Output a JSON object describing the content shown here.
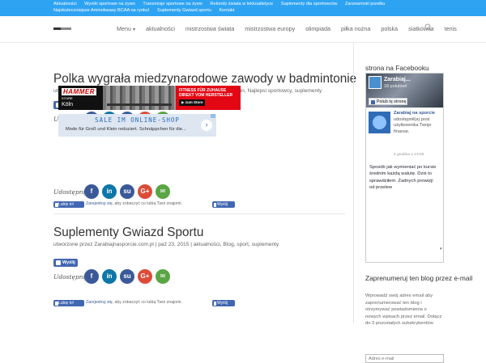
{
  "topbar": {
    "row1": [
      "Aktualności",
      "Wyniki sportowe na żywo",
      "Transmisje sportowe na żywo",
      "Rekordy świata w lekkoatletyce",
      "Suplementy dla sportowców",
      "Zarzewnioki przełku"
    ],
    "row2": [
      "Najskuteczniejsze Aminokwasy BCAA na rynku!",
      "Suplementy Gwiazd sportu",
      "Kontakt"
    ]
  },
  "nav": {
    "items": [
      "Menu",
      "aktualności",
      "mistrzostwa świata",
      "mistrzostwa europy",
      "olimpiada",
      "piłka nożna",
      "polska",
      "siatkówka",
      "tenis"
    ],
    "menu_arrow": "▾"
  },
  "posts": [
    {
      "title": "Polka wygrała miedzynarodowe zawody w badmintonie",
      "meta": "utworzone przez Zarabiajnasporcie.com.pl | lis 17, 2015 | aktualności, badminton, Najlepsi sportowcy, suplementy",
      "like_label": "Wyślij",
      "share_label": "Udostępnij",
      "like_button": "Lubię to!",
      "like_text_link": "Zarejestruj się",
      "like_text_rest": ", aby zobaczyć co lubią Twoi znajomi.",
      "like_mini": "Wyślij"
    },
    {
      "title": "Suplementy Gwiazd Sportu",
      "meta": "utworzone przez Zarabiajnasporcie.com.pl | paź 23, 2015 | aktualności, Blog, sport, suplementy",
      "like_label": "Wyślij",
      "share_label": "Udostępnij",
      "like_button": "Lubię to!",
      "like_text_link": "Zarejestruj się",
      "like_text_rest": ", aby zobaczyć co lubią Twoi znajomi.",
      "like_mini": "Wyślij"
    }
  ],
  "share_buttons": [
    {
      "name": "facebook",
      "glyph": "f",
      "color": "#3b5998"
    },
    {
      "name": "linkedin",
      "glyph": "in",
      "color": "#0e76a8"
    },
    {
      "name": "stumbleupon",
      "glyph": "su",
      "color": "#3b5998"
    },
    {
      "name": "googleplus",
      "glyph": "G+",
      "color": "#dd4b39"
    },
    {
      "name": "email",
      "glyph": "✉",
      "color": "#5aa544"
    }
  ],
  "ads": {
    "hammer": {
      "brand": "HAMMER",
      "store": "STORE",
      "city": "Köln",
      "headline": "FITNESS FÜR ZUHAUSE DIREKT VOM HERSTELLER",
      "cta": "▶ zum Store"
    },
    "sale": {
      "headline": "SALE IM ONLINE-SHOP",
      "body": "Mode für Groß und Klein reduziert. Schnäppchen für die...",
      "arrow": "›"
    }
  },
  "sidebar": {
    "fb_title": "strona na Facebooku",
    "fb_page_name": "Zarabiaj...",
    "fb_page_count": "18 polubień",
    "fb_like_button": "Polub tę stronę",
    "fb_post_author": "Zarabiaj na sporcie",
    "fb_post_header_rest": "udostępnił(a) post użytkownika Twoje finanse.",
    "fb_post_date": "4 grudnia o 13:03",
    "fb_post_text": "Sposób jak wymieniać po kursie średnim każdą walutę. Dziś to sprawdziłem. Żadnych prowizji od przelew",
    "fb_scroll_indicator": "▾",
    "subscribe_title": "Zaprenumeruj ten blog przez e-mail",
    "subscribe_desc": "Wprowadź swój adres email aby zaprenumerować ten blog i otrzymywać powiadomienia o nowych wpisach przez email. Dołącz do 3 pozostałych subskrybentów",
    "email_placeholder": "Adres e-mail"
  }
}
